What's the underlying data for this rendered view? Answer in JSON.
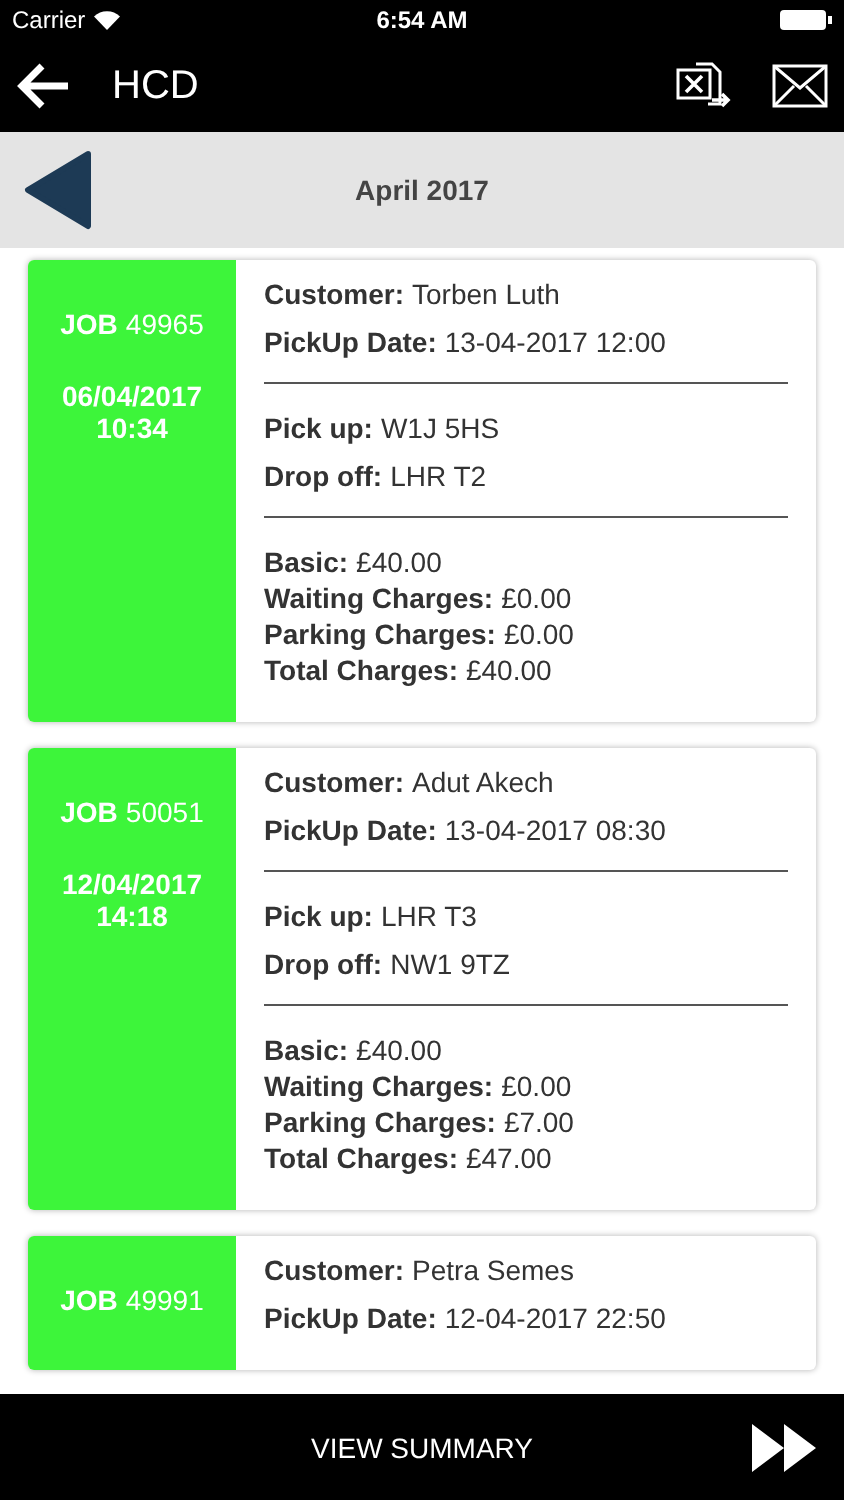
{
  "status_bar": {
    "carrier": "Carrier",
    "time": "6:54 AM"
  },
  "nav_bar": {
    "title": "HCD"
  },
  "month_bar": {
    "title": "April 2017"
  },
  "jobs": [
    {
      "job_label": "JOB",
      "job_number": "49965",
      "created_date": "06/04/2017",
      "created_time": "10:34",
      "sections": [
        [
          {
            "label": "Customer:",
            "value": "Torben Luth"
          },
          {
            "label": "PickUp Date:",
            "value": "13-04-2017 12:00"
          }
        ],
        [
          {
            "label": "Pick up:",
            "value": "W1J 5HS"
          },
          {
            "label": "Drop off:",
            "value": "LHR T2"
          }
        ],
        [
          {
            "label": "Basic:",
            "value": "£40.00"
          },
          {
            "label": "Waiting Charges:",
            "value": "£0.00"
          },
          {
            "label": "Parking Charges:",
            "value": "£0.00"
          },
          {
            "label": "Total Charges:",
            "value": "£40.00"
          }
        ]
      ]
    },
    {
      "job_label": "JOB",
      "job_number": "50051",
      "created_date": "12/04/2017",
      "created_time": "14:18",
      "sections": [
        [
          {
            "label": "Customer:",
            "value": "Adut Akech"
          },
          {
            "label": "PickUp Date:",
            "value": "13-04-2017 08:30"
          }
        ],
        [
          {
            "label": "Pick up:",
            "value": "LHR T3"
          },
          {
            "label": "Drop off:",
            "value": "NW1 9TZ"
          }
        ],
        [
          {
            "label": "Basic:",
            "value": "£40.00"
          },
          {
            "label": "Waiting Charges:",
            "value": "£0.00"
          },
          {
            "label": "Parking Charges:",
            "value": "£7.00"
          },
          {
            "label": "Total Charges:",
            "value": "£47.00"
          }
        ]
      ]
    },
    {
      "job_label": "JOB",
      "job_number": "49991",
      "sections": [
        [
          {
            "label": "Customer:",
            "value": "Petra Semes"
          },
          {
            "label": "PickUp Date:",
            "value": "12-04-2017 22:50"
          }
        ]
      ]
    }
  ],
  "footer": {
    "button": "VIEW SUMMARY"
  }
}
